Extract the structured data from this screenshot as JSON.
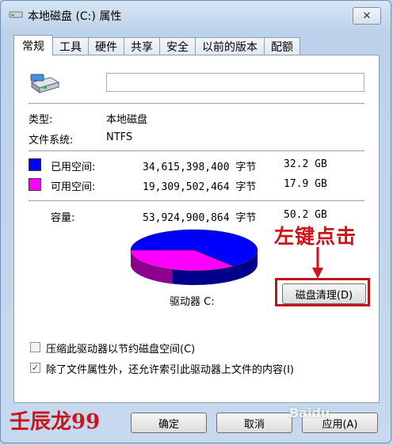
{
  "window": {
    "title": "本地磁盘 (C:) 属性",
    "close_label": "✕"
  },
  "tabs": [
    "常规",
    "工具",
    "硬件",
    "共享",
    "安全",
    "以前的版本",
    "配额"
  ],
  "general": {
    "name_value": "",
    "type_label": "类型:",
    "type_value": "本地磁盘",
    "fs_label": "文件系统:",
    "fs_value": "NTFS",
    "used": {
      "label": "已用空间:",
      "bytes": "34,615,398,400 字节",
      "size": "32.2 GB",
      "color": "#0000ff"
    },
    "free": {
      "label": "可用空间:",
      "bytes": "19,309,502,464 字节",
      "size": "17.9 GB",
      "color": "#ff00ff"
    },
    "capacity": {
      "label": "容量:",
      "bytes": "53,924,900,864 字节",
      "size": "50.2 GB"
    },
    "drive_label": "驱动器 C:",
    "cleanup_button": "磁盘清理(D)",
    "compress_label": "压缩此驱动器以节约磁盘空间(C)",
    "compress_checked": false,
    "index_label": "除了文件属性外，还允许索引此驱动器上文件的内容(I)",
    "index_checked": true,
    "index_mark": "✓"
  },
  "chart_data": {
    "type": "pie",
    "categories": [
      "已用空间",
      "可用空间"
    ],
    "values": [
      32.2,
      17.9
    ],
    "colors": [
      "#0000ff",
      "#ff00ff"
    ]
  },
  "buttons": {
    "ok": "确定",
    "cancel": "取消",
    "apply": "应用(A)"
  },
  "annotation": {
    "text": "左键点击",
    "watermark": "壬辰龙99",
    "baidu_mark": "Baidu"
  }
}
